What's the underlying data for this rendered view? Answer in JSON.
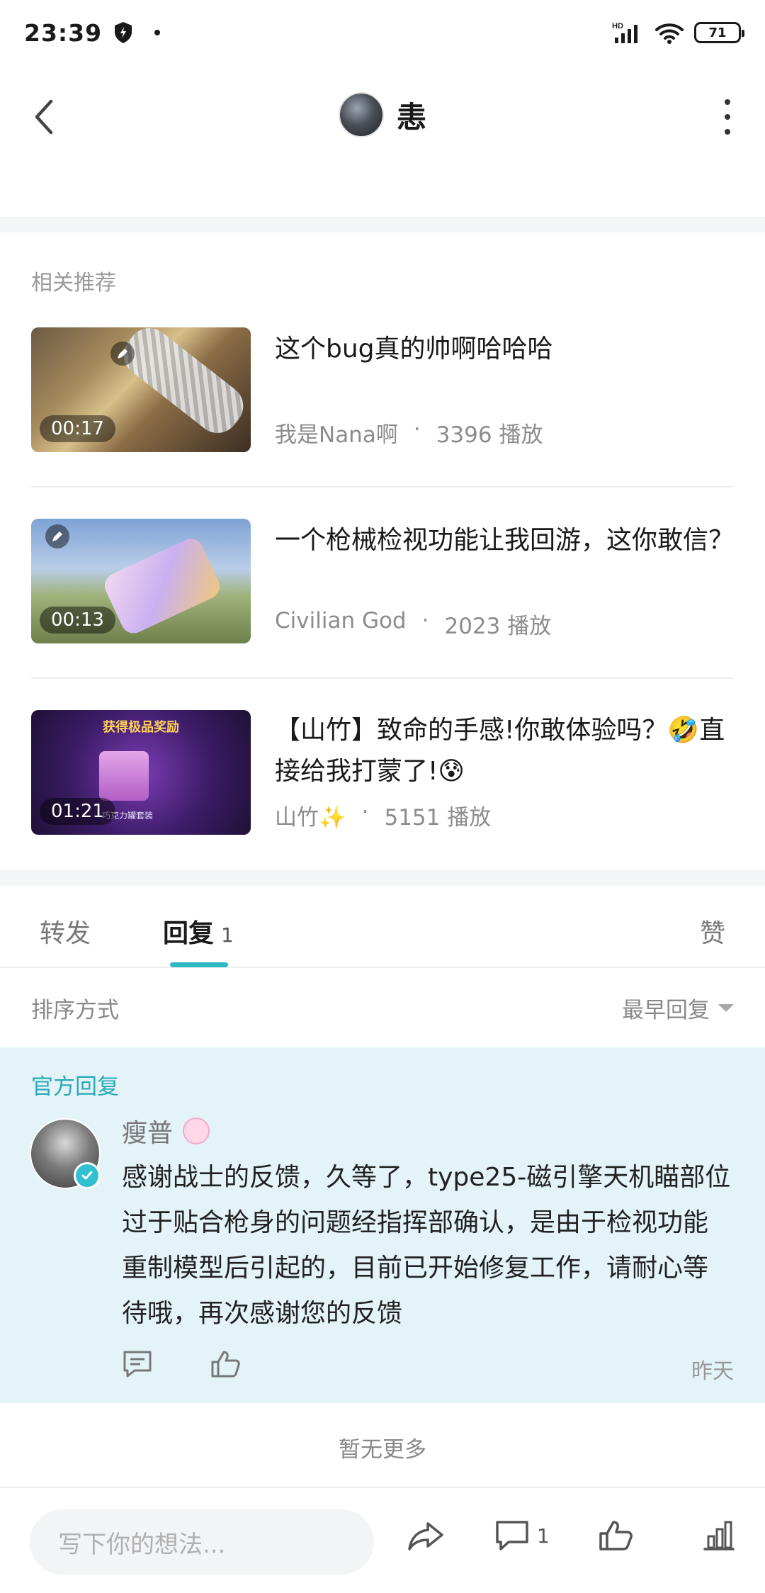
{
  "status": {
    "time": "23:39",
    "network": "HD",
    "battery": "71"
  },
  "header": {
    "title": "恚"
  },
  "related": {
    "title": "相关推荐",
    "videos": [
      {
        "title": "这个bug真的帅啊哈哈哈",
        "author": "我是Nana啊",
        "dot": "·",
        "plays": "3396 播放",
        "duration": "00:17"
      },
      {
        "title": "一个枪械检视功能让我回游，这你敢信？",
        "author": "Civilian God",
        "dot": "·",
        "plays": "2023 播放",
        "duration": "00:13"
      },
      {
        "title": "【山竹】致命的手感!你敢体验吗？🤣直接给我打蒙了!😰",
        "author": "山竹✨",
        "dot": "·",
        "plays": "5151 播放",
        "duration": "01:21",
        "banner": "获得极品奖励",
        "sub": "巧克力罐套装"
      }
    ]
  },
  "tabs": {
    "forward": "转发",
    "reply": "回复",
    "reply_count": "1",
    "like": "赞"
  },
  "sort": {
    "label": "排序方式",
    "value": "最早回复"
  },
  "official": {
    "label": "官方回复",
    "user": "瘦普",
    "text": "感谢战士的反馈，久等了，type25-磁引擎天机瞄部位过于贴合枪身的问题经指挥部确认，是由于检视功能重制模型后引起的，目前已开始修复工作，请耐心等待哦，再次感谢您的反馈",
    "time": "昨天"
  },
  "no_more": "暂无更多",
  "bottom": {
    "placeholder": "写下你的想法...",
    "comment_count": "1"
  },
  "colors": {
    "accent": "#2eb8c6",
    "official_bg": "#e3f3f8"
  }
}
